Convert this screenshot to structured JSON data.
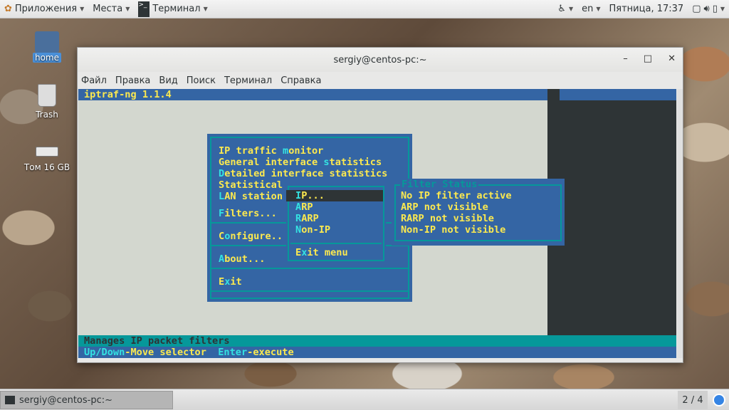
{
  "topbar": {
    "apps": "Приложения",
    "places": "Места",
    "terminal": "Терминал",
    "lang": "en",
    "clock": "Пятница, 17:37"
  },
  "desktop": {
    "icons": [
      {
        "label": "home"
      },
      {
        "label": "Trash"
      },
      {
        "label": "Том 16 GB"
      }
    ]
  },
  "window": {
    "title": "sergiy@centos-pc:~",
    "menu": [
      "Файл",
      "Правка",
      "Вид",
      "Поиск",
      "Терминал",
      "Справка"
    ]
  },
  "term": {
    "header": "iptraf-ng 1.1.4",
    "main_menu": [
      {
        "pre": "IP traffic ",
        "key": "m",
        "post": "onitor"
      },
      {
        "pre": "General interface ",
        "key": "s",
        "post": "tatistics"
      },
      {
        "pre": "",
        "key": "D",
        "post": "etailed interface statistics"
      },
      {
        "pre": "Statistical",
        "key": "",
        "post": ""
      },
      {
        "pre": "",
        "key": "L",
        "post": "AN station"
      },
      {
        "pre": "",
        "key": "F",
        "post": "ilters..."
      },
      {
        "pre": "C",
        "key": "o",
        "post": "nfigure.."
      },
      {
        "pre": "",
        "key": "A",
        "post": "bout..."
      },
      {
        "pre": "E",
        "key": "x",
        "post": "it"
      }
    ],
    "filter_menu": [
      {
        "pre": "",
        "key": "I",
        "post": "P..."
      },
      {
        "pre": "",
        "key": "A",
        "post": "RP"
      },
      {
        "pre": "",
        "key": "R",
        "post": "ARP"
      },
      {
        "pre": "",
        "key": "N",
        "post": "on-IP"
      },
      {
        "pre": "E",
        "key": "x",
        "post": "it menu"
      }
    ],
    "filter_status": {
      "title": "Filter Status",
      "lines": [
        "No IP filter active",
        "ARP not visible",
        "RARP not visible",
        "Non-IP not visible"
      ]
    },
    "status_line": "Manages IP packet filters",
    "help": {
      "k1": "Up/Down",
      "t1": "-Move selector  ",
      "k2": "Enter",
      "t2": "-execute"
    }
  },
  "taskbar": {
    "item": "sergiy@centos-pc:~",
    "workspace": "2 / 4"
  }
}
